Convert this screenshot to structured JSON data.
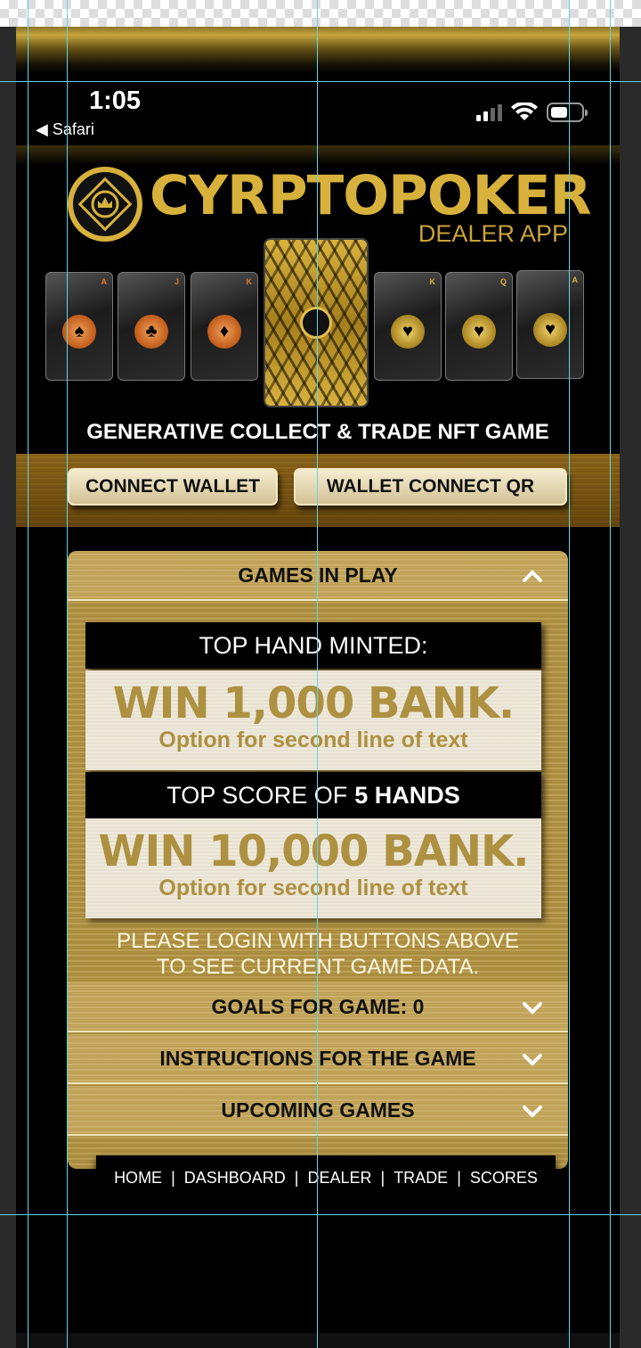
{
  "status_bar": {
    "time": "1:05",
    "back_label": "◀ Safari"
  },
  "header": {
    "brand": "CYRPTOPOKER",
    "subtitle": "DEALER APP",
    "tagline": "GENERATIVE COLLECT & TRADE NFT GAME"
  },
  "cards": [
    {
      "rank": "A",
      "suit": "♠",
      "theme": "orange"
    },
    {
      "rank": "J",
      "suit": "♣",
      "theme": "orange"
    },
    {
      "rank": "K",
      "suit": "♦",
      "theme": "orange"
    },
    {
      "rank": "K",
      "suit": "♥",
      "theme": "gold"
    },
    {
      "rank": "Q",
      "suit": "♥",
      "theme": "gold"
    },
    {
      "rank": "A",
      "suit": "♥",
      "theme": "gold"
    }
  ],
  "wallet": {
    "connect_label": "CONNECT WALLET",
    "qr_label": "WALLET CONNECT QR"
  },
  "games_panel": {
    "title": "GAMES IN PLAY",
    "prize1": {
      "heading": "TOP HAND MINTED:",
      "amount": "WIN 1,000 BANK.",
      "note": "Option for second line of text"
    },
    "prize2": {
      "heading_prefix": "TOP SCORE OF",
      "heading_bold": "5 HANDS",
      "amount": "WIN 10,000 BANK.",
      "note": "Option for second line of text"
    },
    "login_note_1": "PLEASE LOGIN WITH BUTTONS ABOVE",
    "login_note_2": "TO SEE CURRENT GAME DATA."
  },
  "accordions": {
    "goals": "GOALS FOR GAME: 0",
    "instructions": "INSTRUCTIONS FOR THE GAME",
    "upcoming": "UPCOMING GAMES"
  },
  "nav": {
    "items": [
      "HOME",
      "DASHBOARD",
      "DEALER",
      "TRADE",
      "SCORES"
    ]
  },
  "colors": {
    "gold": "#d7b13b",
    "guide": "#5fd6e6",
    "background": "#000000"
  }
}
